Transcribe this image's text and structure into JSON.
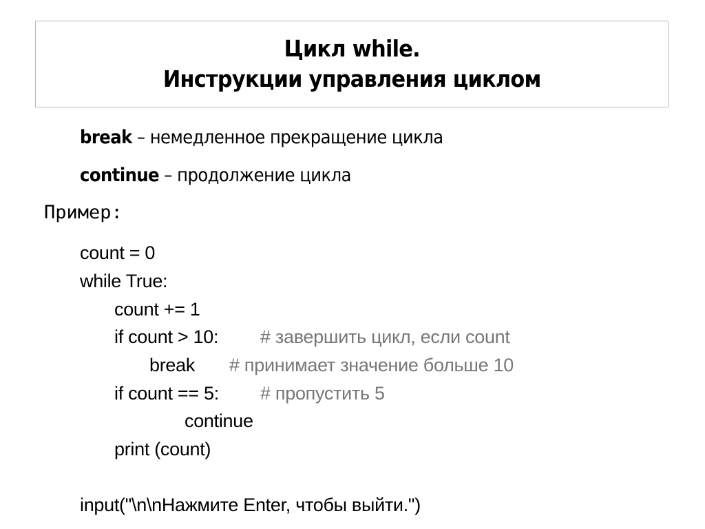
{
  "slide": {
    "title": {
      "line1": "Цикл while.",
      "line2": "Инструкции управления циклом"
    },
    "definitions": [
      {
        "keyword": "break",
        "description": " – немедленное прекращение цикла"
      },
      {
        "keyword": "continue",
        "description": " – продолжение цикла"
      }
    ],
    "example_label": "Пример:",
    "code": {
      "line1": "count = 0",
      "line2": "while  True:",
      "line3": "count += 1",
      "line4": "if count > 10:",
      "line4_comment": "# завершить цикл, если count",
      "line5": "break",
      "line5_comment": "# принимает значение больше 10",
      "line6": "if count == 5:",
      "line6_comment": "# пропустить 5",
      "line7": "continue",
      "line8": "print (count)",
      "line9": "input(\"\\n\\nНажмите Enter, чтобы выйти.\")"
    },
    "colors": {
      "text": "#000000",
      "comment": "#777777",
      "title_border": "#b8b8b8",
      "background": "#ffffff"
    }
  }
}
